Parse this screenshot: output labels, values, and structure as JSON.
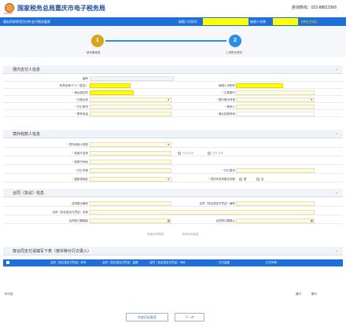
{
  "header": {
    "logo_text": "Taxation",
    "title": "国家税务总局重庆市电子税务局",
    "hotline": "咨询热线：023-88812366"
  },
  "blue_bar": {
    "crumb": "服务贸易等项目对外支付税务备案",
    "taxid_label": "纳税人识别号",
    "name_label": "纳税人名称",
    "unit_type": "【单位主体】"
  },
  "steps": [
    {
      "num": "1",
      "label": "填写备案表"
    },
    {
      "num": "2",
      "label": "上传附列资料"
    }
  ],
  "sections": {
    "domestic": {
      "title": "境内支付人信息",
      "fields": {
        "biaohao": "编号",
        "org_code": "机构名称/个人（姓名）",
        "payer_id": "纳税人识别号",
        "address": "地址或住所",
        "district": "汇款银行",
        "admin_area": "行政区划",
        "bank_branch": "银行登记号或",
        "pay_account": "付汇账号",
        "contact": "联系人",
        "phone": "联系电话",
        "business": "营业执照号码"
      }
    },
    "foreign": {
      "title": "境外收款人信息",
      "fields": {
        "payee_type": "境外收款人类型",
        "payee_name": "收款方名称",
        "payee_addr": "收款方地址",
        "pay_currency": "付汇币种",
        "pay_account": "付汇账号",
        "country": "国家或地区",
        "nonresident": "境内外机构是否关联",
        "radio_org": "非空名称",
        "radio_person": "境外名称",
        "yes": "是",
        "no": "否"
      }
    },
    "contract": {
      "title": "合同（协议）信息",
      "fields": {
        "contract_no": "合同登记编号",
        "contract_name_cn": "合同（协议或支付凭证）编号",
        "contract_name": "合同（协议或支付凭证）名称",
        "sign_date": "合同签订期限起",
        "end_date": "合同签订期限止"
      },
      "btn_add": "新增合同信息",
      "btn_query": "查询合同信息"
    },
    "payment": {
      "title": "按合同支付请填写下表（按币种分行次录入）",
      "columns": [
        "合同（协议或支付凭证）序号",
        "合同（协议或支付凭证）金额",
        "合同（协议或支付凭证）币种",
        "已付金额",
        "已付币种"
      ],
      "total_label": "本行结",
      "add_row": "增行",
      "del_row": "删行"
    }
  },
  "bottom": {
    "prev": "作废历史备案",
    "next": "下一步"
  },
  "colors": {
    "brand": "#1e6fd9",
    "step1": "#d9a520",
    "step2": "#2a8ee6",
    "highlight": "#ffff00"
  }
}
